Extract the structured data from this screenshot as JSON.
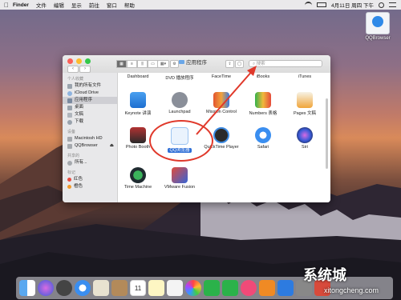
{
  "menubar": {
    "apple": "",
    "items": [
      "Finder",
      "文件",
      "编辑",
      "显示",
      "前往",
      "窗口",
      "帮助"
    ],
    "clock": "4月11日 周四 下午"
  },
  "desktop_icon": {
    "label": "QQBrowser"
  },
  "window": {
    "title": "应用程序",
    "nav_back": "‹",
    "nav_forward": "›",
    "search_placeholder": "搜索"
  },
  "sidebar": {
    "sections": [
      {
        "header": "个人收藏",
        "items": [
          "我的所有文件",
          "iCloud Drive",
          "应用程序",
          "桌面",
          "文稿",
          "下载"
        ]
      },
      {
        "header": "设备",
        "items": [
          "Macintosh HD",
          "QQBrowser"
        ]
      },
      {
        "header": "共享的",
        "items": [
          "所有..."
        ]
      },
      {
        "header": "标记",
        "items": [
          "红色",
          "橙色"
        ]
      }
    ]
  },
  "apps": {
    "row0": [
      "Dashboard",
      "DVD 播放程序",
      "FaceTime",
      "iBooks",
      "iTunes"
    ],
    "row1": [
      "Keynote 讲演",
      "Launchpad",
      "Mission Control",
      "Numbers 表格",
      "Pages 文稿"
    ],
    "row2": [
      "Photo Booth",
      "QQ浏览器",
      "QuickTime Player",
      "Safari",
      "Siri"
    ],
    "row3": [
      "Time Machine",
      "VMware Fusion"
    ]
  },
  "watermark": {
    "main": "系统城",
    "site": "xitongcheng.com"
  },
  "colors": {
    "accent": "#2f6fd6",
    "annotation": "#e0392b"
  }
}
